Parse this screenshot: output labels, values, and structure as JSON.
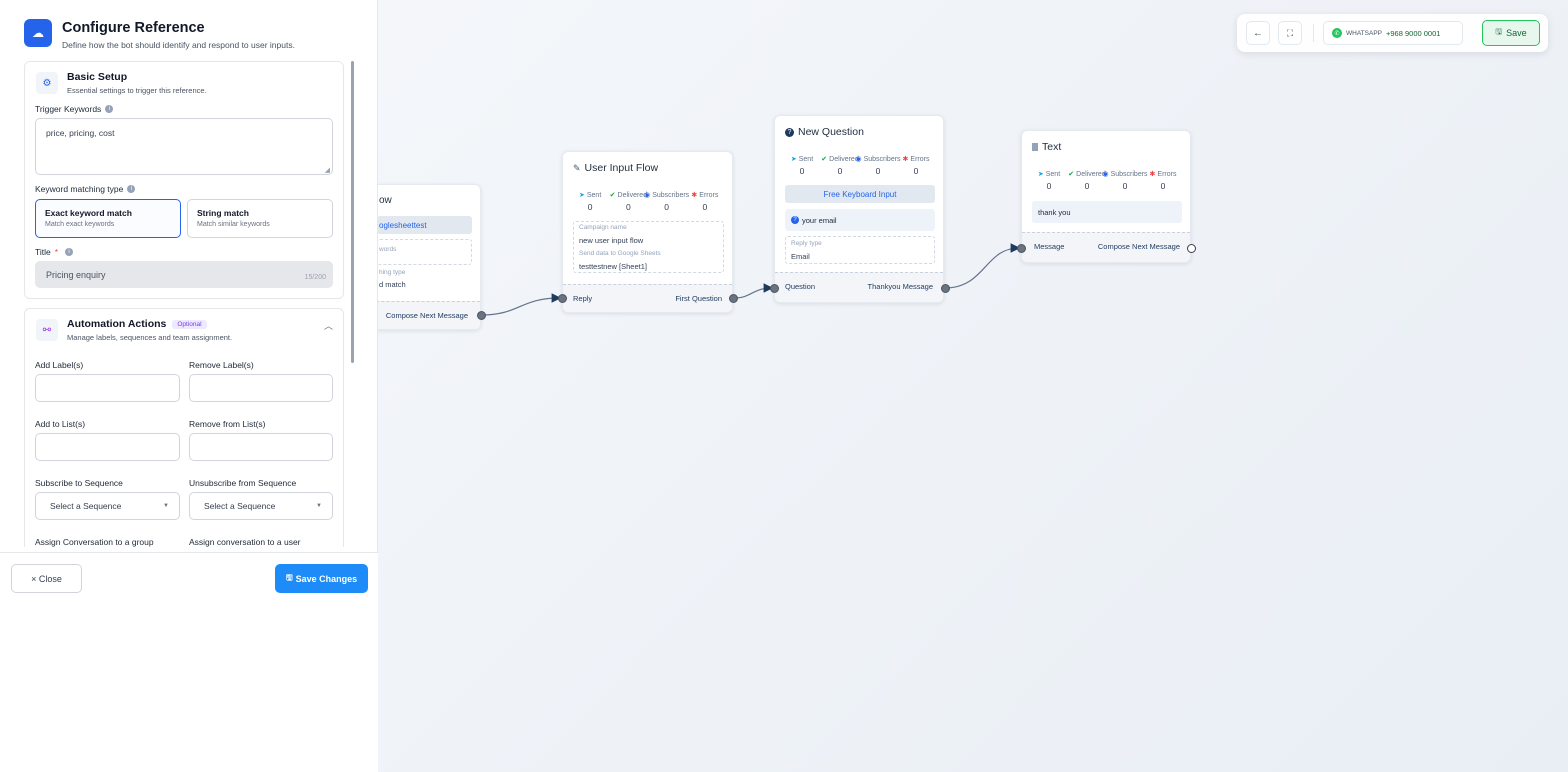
{
  "canvas": {
    "node_partial": {
      "title": "ow",
      "chip": "oglesheettest",
      "keywords_label": "words",
      "matching_label": "hing type",
      "matching_value": "d match",
      "footer_right": "Compose Next Message"
    },
    "node_user_input": {
      "title": "User Input Flow",
      "stats": [
        {
          "label": "Sent",
          "value": "0"
        },
        {
          "label": "Delivered",
          "value": "0"
        },
        {
          "label": "Subscribers",
          "value": "0"
        },
        {
          "label": "Errors",
          "value": "0"
        }
      ],
      "campaign_label": "Campaign name",
      "campaign_value": "new user input flow",
      "sheets_label": "Send data to Google Sheets",
      "sheets_value": "testtestnew [Sheet1]",
      "footer_left": "Reply",
      "footer_right": "First Question"
    },
    "node_question": {
      "title": "New Question",
      "stats": [
        {
          "label": "Sent",
          "value": "0"
        },
        {
          "label": "Delivered",
          "value": "0"
        },
        {
          "label": "Subscribers",
          "value": "0"
        },
        {
          "label": "Errors",
          "value": "0"
        }
      ],
      "keyboard_btn": "Free Keyboard Input",
      "question_text": "your email",
      "reply_type_label": "Reply type",
      "reply_type_value": "Email",
      "footer_left": "Question",
      "footer_right": "Thankyou Message"
    },
    "node_text": {
      "title": "Text",
      "stats": [
        {
          "label": "Sent",
          "value": "0"
        },
        {
          "label": "Delivered",
          "value": "0"
        },
        {
          "label": "Subscribers",
          "value": "0"
        },
        {
          "label": "Errors",
          "value": "0"
        }
      ],
      "message": "thank you",
      "footer_left": "Message",
      "footer_right": "Compose Next Message"
    }
  },
  "toolbar": {
    "back_icon": "arrow-left-icon",
    "fit_icon": "fit-view-icon",
    "whatsapp_label": "WHATSAPP",
    "whatsapp_number": "+968 9000 0001",
    "save_label": "Save"
  },
  "panel": {
    "title": "Configure Reference",
    "subtitle": "Define how the bot should identify and respond to user inputs.",
    "basic_setup": {
      "title": "Basic Setup",
      "subtitle": "Essential settings to trigger this reference.",
      "trigger_label": "Trigger Keywords",
      "trigger_value": "price, pricing, cost",
      "matching_label": "Keyword matching type",
      "options": [
        {
          "title": "Exact keyword match",
          "sub": "Match exact keywords"
        },
        {
          "title": "String match",
          "sub": "Match similar keywords"
        }
      ],
      "title_label": "Title",
      "required_mark": "*",
      "title_value": "Pricing enquiry",
      "title_counter": "15/200"
    },
    "automation": {
      "title": "Automation Actions",
      "badge": "Optional",
      "subtitle": "Manage labels, sequences and team assignment.",
      "add_labels": "Add Label(s)",
      "remove_labels": "Remove Label(s)",
      "add_list": "Add to List(s)",
      "remove_list": "Remove from List(s)",
      "subscribe_seq": "Subscribe to Sequence",
      "unsubscribe_seq": "Unsubscribe from Sequence",
      "select_seq_placeholder": "Select a Sequence",
      "assign_cut_1": "Assign Conversation to a group",
      "assign_cut_2": "Assign conversation to a user"
    },
    "footer": {
      "close_label": "× Close",
      "save_label": "Save Changes"
    }
  },
  "colors": {
    "primary": "#2563eb",
    "save_button": "#1d8cf8",
    "whatsapp_green": "#22c55e",
    "edge": "#64748b"
  }
}
